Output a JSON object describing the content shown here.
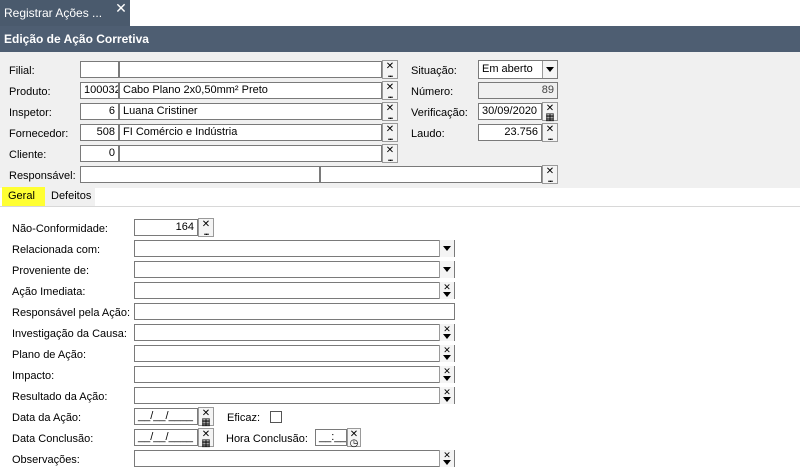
{
  "window": {
    "tab_title": "Registrar Ações ...",
    "close_glyph": "✕",
    "header_title": "Edição de Ação Corretiva"
  },
  "fields": {
    "filial": {
      "label": "Filial:",
      "code": "",
      "text": ""
    },
    "produto": {
      "label": "Produto:",
      "code": "100032",
      "text": "Cabo Plano 2x0,50mm² Preto"
    },
    "inspetor": {
      "label": "Inspetor:",
      "code": "6",
      "text": "Luana Cristiner"
    },
    "fornecedor": {
      "label": "Fornecedor:",
      "code": "508",
      "text": "FI Comércio e Indústria"
    },
    "cliente": {
      "label": "Cliente:",
      "code": "0",
      "text": ""
    },
    "responsavel": {
      "label": "Responsável:",
      "code": "",
      "text": ""
    },
    "situacao": {
      "label": "Situação:",
      "value": "Em aberto"
    },
    "numero": {
      "label": "Número:",
      "value": "89"
    },
    "verificacao": {
      "label": "Verificação:",
      "value": "30/09/2020"
    },
    "laudo": {
      "label": "Laudo:",
      "value": "23.756"
    }
  },
  "tabs": [
    {
      "label": "Geral",
      "active": true
    },
    {
      "label": "Defeitos",
      "active": false
    }
  ],
  "geral": {
    "nao_conformidade": {
      "label": "Não-Conformidade:",
      "value": "164"
    },
    "relacionada": {
      "label": "Relacionada com:",
      "value": ""
    },
    "proveniente": {
      "label": "Proveniente de:",
      "value": ""
    },
    "acao_imediata": {
      "label": "Ação Imediata:",
      "value": ""
    },
    "responsavel_acao": {
      "label": "Responsável pela Ação:",
      "value": ""
    },
    "investigacao": {
      "label": "Investigação da Causa:",
      "value": ""
    },
    "plano_acao": {
      "label": "Plano de Ação:",
      "value": ""
    },
    "impacto": {
      "label": "Impacto:",
      "value": ""
    },
    "resultado": {
      "label": "Resultado da Ação:",
      "value": ""
    },
    "data_acao": {
      "label": "Data da Ação:",
      "value": "__/__/____"
    },
    "eficaz": {
      "label": "Eficaz:",
      "checked": false
    },
    "data_conclusao": {
      "label": "Data Conclusão:",
      "value": "__/__/____"
    },
    "hora_conclusao": {
      "label": "Hora Conclusão:",
      "value": "__:__"
    },
    "observacoes": {
      "label": "Observações:",
      "value": ""
    }
  },
  "icons": {
    "lookup": "lookup-icon",
    "dropdown": "chevron-down-icon",
    "calendar": "calendar-icon",
    "clock": "clock-icon"
  }
}
